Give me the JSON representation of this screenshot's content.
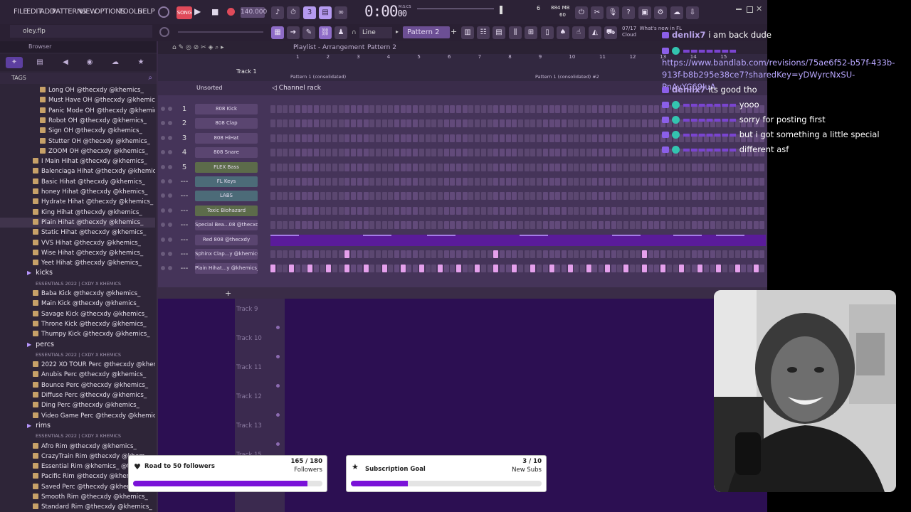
{
  "menu": [
    "FILE",
    "EDIT",
    "ADD",
    "PATTERNS",
    "VIEW",
    "OPTIONS",
    "TOOLS",
    "HELP"
  ],
  "transport": {
    "tempo": "140.000",
    "time": "0:00",
    "time_fraction": "00",
    "time_unit": "M:S:CS",
    "cpu": "6",
    "mem": "884 MB",
    "poly": "60"
  },
  "toolbar": {
    "pattern": "Pattern 2",
    "snap": "Line",
    "file": "oley.flp",
    "news_date": "07/17",
    "news": "What's new in FL",
    "news2": "Cloud"
  },
  "browser": {
    "title": "Browser",
    "tags": "TAGS",
    "items": [
      {
        "t": "Long OH @thecxdy @khemics_"
      },
      {
        "t": "Must Have OH @thecxdy @khemics_"
      },
      {
        "t": "Panic Mode OH @thecxdy @khemics_"
      },
      {
        "t": "Robot OH @thecxdy @khemics_"
      },
      {
        "t": "Sign OH @thecxdy @khemics_"
      },
      {
        "t": "Stutter OH @thecxdy @khemics_"
      },
      {
        "t": "ZOOM OH @thecxdy @khemics_"
      },
      {
        "t": "I Main Hihat @thecxdy @khemics_"
      },
      {
        "t": "Balenciaga Hihat @thecxdy @khemics_"
      },
      {
        "t": "Basic Hihat @thecxdy @khemics_"
      },
      {
        "t": "honey Hihat @thecxdy @khemics_"
      },
      {
        "t": "Hydrate Hihat @thecxdy @khemics_"
      },
      {
        "t": "King Hihat @thecxdy @khemics_"
      },
      {
        "t": "Plain Hihat @thecxdy @khemics_"
      },
      {
        "t": "Static Hihat @thecxdy @khemics_"
      },
      {
        "t": "VVS Hihat @thecxdy @khemics_"
      },
      {
        "t": "Wise Hihat @thecxdy @khemics_"
      },
      {
        "t": "Yeet Hihat @thecxdy @khemics_"
      }
    ],
    "kicks_folder": "kicks",
    "kicks_ess": "ESSENTIALS 2022 | CXDY X KHEMICS",
    "kicks": [
      "Baba Kick @thecxdy @khemics_",
      "Main Kick @thecxdy @khemics_",
      "Savage Kick @thecxdy @khemics_",
      "Throne Kick @thecxdy @khemics_",
      "Thumpy Kick @thecxdy @khemics_"
    ],
    "percs_folder": "percs",
    "percs_ess": "ESSENTIALS 2022 | CXDY X KHEMICS",
    "percs": [
      "2022 XO TOUR Perc @thecxdy @khemics_",
      "Anubis Perc @thecxdy @khemics_",
      "Bounce Perc @thecxdy @khemics_",
      "Diffuse Perc @thecxdy @khemics_",
      "Ding Perc @thecxdy @khemics_",
      "Video Game Perc @thecxdy @khemics_"
    ],
    "rims_folder": "rims",
    "rims_ess": "ESSENTIALS 2022 | CXDY X KHEMICS",
    "rims": [
      "Afro Rim @thecxdy @khemics_",
      "CrazyTrain Rim @thecxdy @khem",
      "Essential Rim @khemics_ @the",
      "Pacific Rim @thecxdy @khemics",
      "Saved Perc @thecxdy @khemics_",
      "Smooth Rim @thecxdy @khemics_",
      "Standard Rim @thecxdy @khemics_"
    ]
  },
  "playlist": {
    "title": "Playlist - Arrangement",
    "pattern": "Pattern 2",
    "track1": "Track 1",
    "pattern1": "Pattern 1 (consolidated)",
    "pattern1b": "Pattern 1 (consolidated) #2",
    "ticks": [
      "1",
      "2",
      "3",
      "4",
      "5",
      "6",
      "7",
      "8",
      "9",
      "10",
      "11",
      "12",
      "13",
      "14",
      "15"
    ],
    "tracks": [
      "Track 9",
      "Track 10",
      "Track 11",
      "Track 12",
      "Track 13",
      "Track 15"
    ]
  },
  "rack": {
    "filter": "Unsorted",
    "title": "Channel rack",
    "channels": [
      {
        "num": "1",
        "name": "808 Kick"
      },
      {
        "num": "2",
        "name": "808 Clap"
      },
      {
        "num": "3",
        "name": "808 HiHat"
      },
      {
        "num": "4",
        "name": "808 Snare"
      },
      {
        "num": "5",
        "name": "FLEX Bass"
      },
      {
        "num": "---",
        "name": "FL Keys"
      },
      {
        "num": "---",
        "name": "LABS"
      },
      {
        "num": "---",
        "name": "Toxic Biohazard"
      },
      {
        "num": "---",
        "name": "Special Bea...08 @thecxdy"
      },
      {
        "num": "---",
        "name": "Red 808 @thecxdy"
      },
      {
        "num": "---",
        "name": "Sphinx Clap...y @khemics_"
      },
      {
        "num": "---",
        "name": "Plain Hihat...y @khemics_"
      }
    ]
  },
  "chat": {
    "lines": [
      {
        "user": "denlix7",
        "msg": "i am back dude"
      },
      {
        "user": "",
        "msg": "https://www.bandlab.com/revisions/75ae6f52-b57f-433b-913f-b8b295e38ce7?sharedKey=yDWyrcNxSU-PnAyYC69IuA"
      },
      {
        "user": "denlix7",
        "msg": "its good tho"
      },
      {
        "user": "",
        "msg": "yooo"
      },
      {
        "user": "",
        "msg": "sorry for posting first"
      },
      {
        "user": "",
        "msg": "but i got something a little special"
      },
      {
        "user": "",
        "msg": "different asf"
      }
    ]
  },
  "goals": [
    {
      "title": "Road to 50 followers",
      "value": "165 / 180",
      "unit": "Followers",
      "progress": 0.92
    },
    {
      "title": "Subscription Goal",
      "value": "3 / 10",
      "unit": "New Subs",
      "progress": 0.3
    }
  ],
  "colors": {
    "accent": "#7a12d8",
    "rack_bg": "#453459",
    "step_on": "#e5a0ec",
    "playlist_bg": "#2c0f52"
  }
}
